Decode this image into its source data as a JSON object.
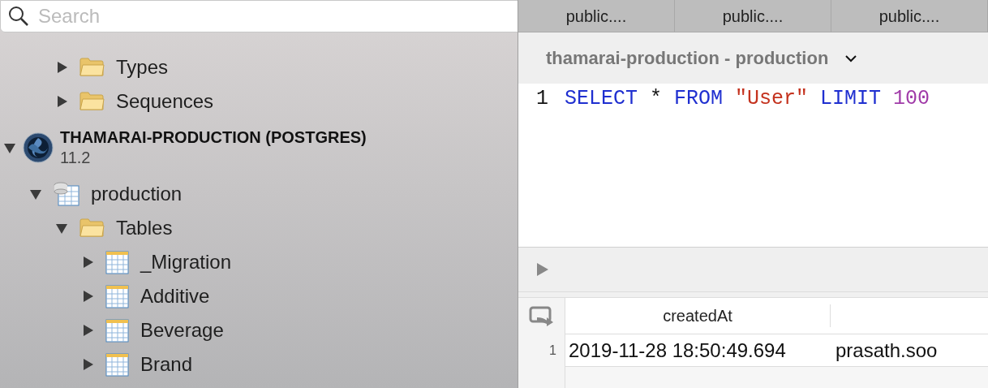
{
  "sidebar": {
    "search": {
      "placeholder": "Search"
    },
    "continued_items": [
      {
        "name": "Types",
        "kind": "folder",
        "expanded": false
      },
      {
        "name": "Sequences",
        "kind": "folder",
        "expanded": false
      }
    ],
    "connections": [
      {
        "name": "THAMARAI-PRODUCTION (POSTGRES)",
        "version": "11.2",
        "expanded": true,
        "children": [
          {
            "name": "production",
            "kind": "database",
            "expanded": true,
            "children": [
              {
                "name": "Tables",
                "kind": "folder",
                "expanded": true,
                "children": [
                  {
                    "name": "_Migration",
                    "kind": "table",
                    "expanded": false
                  },
                  {
                    "name": "Additive",
                    "kind": "table",
                    "expanded": false
                  },
                  {
                    "name": "Beverage",
                    "kind": "table",
                    "expanded": false
                  },
                  {
                    "name": "Brand",
                    "kind": "table",
                    "expanded": false
                  }
                ]
              }
            ]
          }
        ]
      }
    ]
  },
  "tabs": [
    {
      "label": "public....",
      "selected": false
    },
    {
      "label": "public....",
      "selected": false
    },
    {
      "label": "public....",
      "selected": false
    }
  ],
  "editor": {
    "connection": "thamarai-production - production",
    "lines": [
      {
        "number": "1",
        "tokens": [
          {
            "text": "SELECT",
            "kind": "keyword"
          },
          {
            "text": "*",
            "kind": "plain"
          },
          {
            "text": "FROM",
            "kind": "keyword"
          },
          {
            "text": "\"User\"",
            "kind": "string"
          },
          {
            "text": "LIMIT",
            "kind": "keyword"
          },
          {
            "text": "100",
            "kind": "number"
          }
        ]
      }
    ]
  },
  "results": {
    "columns": [
      "createdAt"
    ],
    "rows": [
      {
        "number": "1",
        "cells": [
          "2019-11-28 18:50:49.694",
          "prasath.soo"
        ]
      }
    ]
  }
}
